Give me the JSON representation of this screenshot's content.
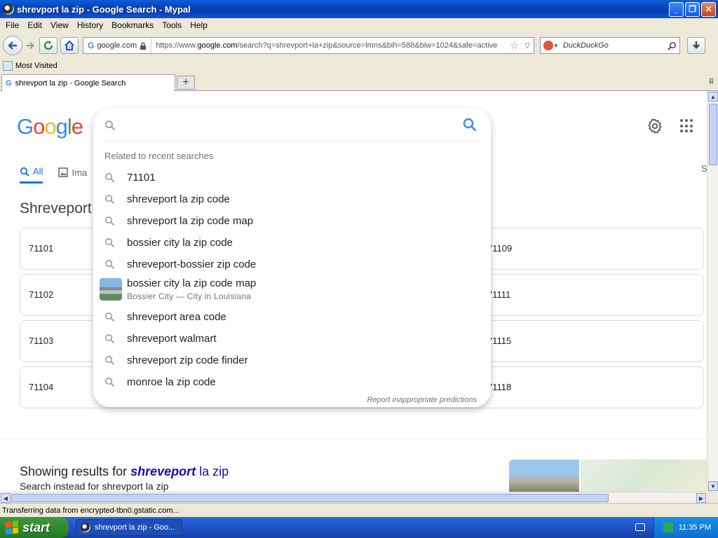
{
  "window": {
    "title": "shrevport la zip - Google Search - Mypal",
    "minimize": "_",
    "restore": "❐",
    "close": "✕"
  },
  "menu": [
    "File",
    "Edit",
    "View",
    "History",
    "Bookmarks",
    "Tools",
    "Help"
  ],
  "toolbar": {
    "site_label": "google.com",
    "url_prefix": "https://www.",
    "url_domain": "google.com",
    "url_rest": "/search?q=shrevport+la+zip&source=lmns&bih=588&biw=1024&safe=active",
    "search_placeholder": "DuckDuckGo"
  },
  "bookmarks": {
    "most_visited": "Most Visited"
  },
  "tabs": [
    {
      "label": "shrevport la zip - Google Search"
    }
  ],
  "new_tab": "+",
  "google": {
    "logo_letters": [
      "G",
      "o",
      "o",
      "g",
      "l",
      "e"
    ],
    "logo_colors": [
      "#4285f4",
      "#ea4335",
      "#fbbc05",
      "#4285f4",
      "#34a853",
      "#ea4335"
    ],
    "tabs": {
      "all": "All",
      "images": "Ima",
      "right": "S"
    },
    "heading": "Shreveport",
    "zip_rows": [
      {
        "left": "71101",
        "right": "71109"
      },
      {
        "left": "71102",
        "right": "71111"
      },
      {
        "left": "71103",
        "right": "71115"
      },
      {
        "left": "71104",
        "right": "71118"
      }
    ],
    "showing_prefix": "Showing results for ",
    "showing_bold": "shreveport",
    "showing_suffix": " la zip",
    "search_instead": "Search instead for shrevport la zip"
  },
  "dropdown": {
    "related_header": "Related to recent searches",
    "suggestions": [
      {
        "text": "71101"
      },
      {
        "text": "shreveport la zip code"
      },
      {
        "text": "shreveport la zip code map"
      },
      {
        "text": "bossier city la zip code"
      },
      {
        "text": "shreveport-bossier zip code"
      },
      {
        "text": "bossier city la zip code map",
        "sub": "Bossier City — City in Louisiana"
      },
      {
        "text": "shreveport area code"
      },
      {
        "text": "shreveport walmart"
      },
      {
        "text": "shreveport zip code finder"
      },
      {
        "text": "monroe la zip code"
      }
    ],
    "report": "Report inappropriate predictions"
  },
  "status": "Transferring data from encrypted-tbn0.gstatic.com...",
  "taskbar": {
    "start": "start",
    "task_label": "shrevport la zip - Goo...",
    "clock": "11:35 PM"
  },
  "colors": {
    "accent_blue": "#1a73e8",
    "link": "#1a0dab"
  }
}
